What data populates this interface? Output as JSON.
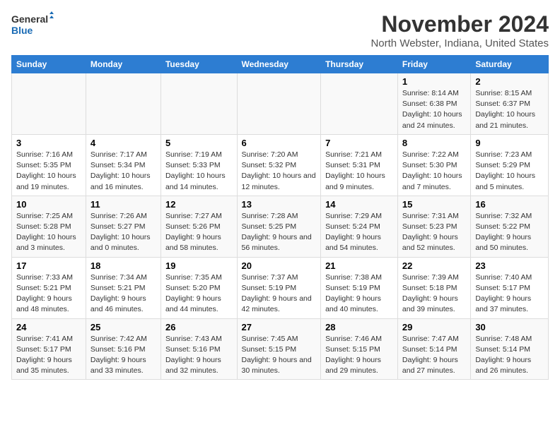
{
  "logo": {
    "text_general": "General",
    "text_blue": "Blue"
  },
  "title": "November 2024",
  "subtitle": "North Webster, Indiana, United States",
  "days_of_week": [
    "Sunday",
    "Monday",
    "Tuesday",
    "Wednesday",
    "Thursday",
    "Friday",
    "Saturday"
  ],
  "weeks": [
    [
      {
        "day": "",
        "info": ""
      },
      {
        "day": "",
        "info": ""
      },
      {
        "day": "",
        "info": ""
      },
      {
        "day": "",
        "info": ""
      },
      {
        "day": "",
        "info": ""
      },
      {
        "day": "1",
        "info": "Sunrise: 8:14 AM\nSunset: 6:38 PM\nDaylight: 10 hours and 24 minutes."
      },
      {
        "day": "2",
        "info": "Sunrise: 8:15 AM\nSunset: 6:37 PM\nDaylight: 10 hours and 21 minutes."
      }
    ],
    [
      {
        "day": "3",
        "info": "Sunrise: 7:16 AM\nSunset: 5:35 PM\nDaylight: 10 hours and 19 minutes."
      },
      {
        "day": "4",
        "info": "Sunrise: 7:17 AM\nSunset: 5:34 PM\nDaylight: 10 hours and 16 minutes."
      },
      {
        "day": "5",
        "info": "Sunrise: 7:19 AM\nSunset: 5:33 PM\nDaylight: 10 hours and 14 minutes."
      },
      {
        "day": "6",
        "info": "Sunrise: 7:20 AM\nSunset: 5:32 PM\nDaylight: 10 hours and 12 minutes."
      },
      {
        "day": "7",
        "info": "Sunrise: 7:21 AM\nSunset: 5:31 PM\nDaylight: 10 hours and 9 minutes."
      },
      {
        "day": "8",
        "info": "Sunrise: 7:22 AM\nSunset: 5:30 PM\nDaylight: 10 hours and 7 minutes."
      },
      {
        "day": "9",
        "info": "Sunrise: 7:23 AM\nSunset: 5:29 PM\nDaylight: 10 hours and 5 minutes."
      }
    ],
    [
      {
        "day": "10",
        "info": "Sunrise: 7:25 AM\nSunset: 5:28 PM\nDaylight: 10 hours and 3 minutes."
      },
      {
        "day": "11",
        "info": "Sunrise: 7:26 AM\nSunset: 5:27 PM\nDaylight: 10 hours and 0 minutes."
      },
      {
        "day": "12",
        "info": "Sunrise: 7:27 AM\nSunset: 5:26 PM\nDaylight: 9 hours and 58 minutes."
      },
      {
        "day": "13",
        "info": "Sunrise: 7:28 AM\nSunset: 5:25 PM\nDaylight: 9 hours and 56 minutes."
      },
      {
        "day": "14",
        "info": "Sunrise: 7:29 AM\nSunset: 5:24 PM\nDaylight: 9 hours and 54 minutes."
      },
      {
        "day": "15",
        "info": "Sunrise: 7:31 AM\nSunset: 5:23 PM\nDaylight: 9 hours and 52 minutes."
      },
      {
        "day": "16",
        "info": "Sunrise: 7:32 AM\nSunset: 5:22 PM\nDaylight: 9 hours and 50 minutes."
      }
    ],
    [
      {
        "day": "17",
        "info": "Sunrise: 7:33 AM\nSunset: 5:21 PM\nDaylight: 9 hours and 48 minutes."
      },
      {
        "day": "18",
        "info": "Sunrise: 7:34 AM\nSunset: 5:21 PM\nDaylight: 9 hours and 46 minutes."
      },
      {
        "day": "19",
        "info": "Sunrise: 7:35 AM\nSunset: 5:20 PM\nDaylight: 9 hours and 44 minutes."
      },
      {
        "day": "20",
        "info": "Sunrise: 7:37 AM\nSunset: 5:19 PM\nDaylight: 9 hours and 42 minutes."
      },
      {
        "day": "21",
        "info": "Sunrise: 7:38 AM\nSunset: 5:19 PM\nDaylight: 9 hours and 40 minutes."
      },
      {
        "day": "22",
        "info": "Sunrise: 7:39 AM\nSunset: 5:18 PM\nDaylight: 9 hours and 39 minutes."
      },
      {
        "day": "23",
        "info": "Sunrise: 7:40 AM\nSunset: 5:17 PM\nDaylight: 9 hours and 37 minutes."
      }
    ],
    [
      {
        "day": "24",
        "info": "Sunrise: 7:41 AM\nSunset: 5:17 PM\nDaylight: 9 hours and 35 minutes."
      },
      {
        "day": "25",
        "info": "Sunrise: 7:42 AM\nSunset: 5:16 PM\nDaylight: 9 hours and 33 minutes."
      },
      {
        "day": "26",
        "info": "Sunrise: 7:43 AM\nSunset: 5:16 PM\nDaylight: 9 hours and 32 minutes."
      },
      {
        "day": "27",
        "info": "Sunrise: 7:45 AM\nSunset: 5:15 PM\nDaylight: 9 hours and 30 minutes."
      },
      {
        "day": "28",
        "info": "Sunrise: 7:46 AM\nSunset: 5:15 PM\nDaylight: 9 hours and 29 minutes."
      },
      {
        "day": "29",
        "info": "Sunrise: 7:47 AM\nSunset: 5:14 PM\nDaylight: 9 hours and 27 minutes."
      },
      {
        "day": "30",
        "info": "Sunrise: 7:48 AM\nSunset: 5:14 PM\nDaylight: 9 hours and 26 minutes."
      }
    ]
  ]
}
